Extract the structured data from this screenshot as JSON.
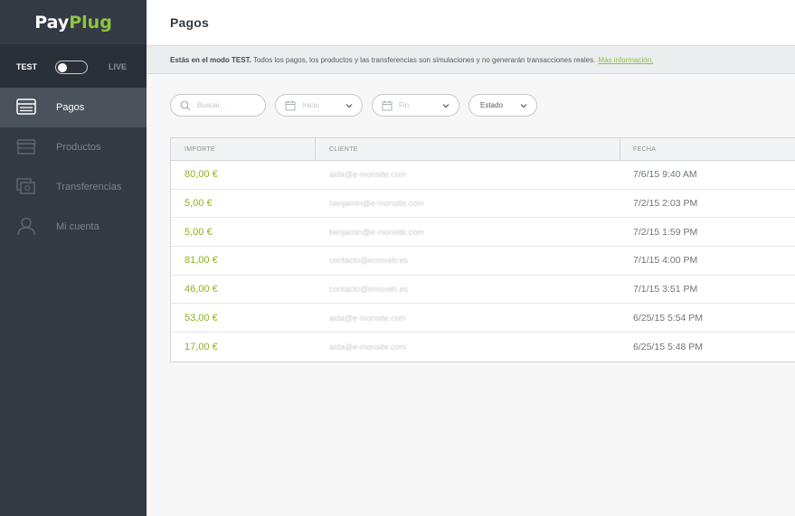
{
  "brand": {
    "part1": "Pay",
    "part2": "Plug",
    "accent": "#8dc63f"
  },
  "mode": {
    "test_label": "TEST",
    "live_label": "LIVE"
  },
  "nav": [
    {
      "label": "Pagos",
      "icon": "payments-list-icon",
      "active": true
    },
    {
      "label": "Productos",
      "icon": "store-icon",
      "active": false
    },
    {
      "label": "Transferencias",
      "icon": "transfers-icon",
      "active": false
    },
    {
      "label": "Mi cuenta",
      "icon": "user-icon",
      "active": false
    }
  ],
  "header": {
    "title": "Pagos"
  },
  "banner": {
    "bold": "Estás en el modo TEST.",
    "text": " Todos los pagos, los productos y las transferencias son simulaciones y no generarán transacciones reales.",
    "link": "Más información."
  },
  "filters": {
    "search_placeholder": "Buscar...",
    "start_placeholder": "Inicio",
    "end_placeholder": "Fin",
    "status_label": "Estado"
  },
  "table": {
    "headers": {
      "amount": "IMPORTE",
      "client": "CLIENTE",
      "date": "FECHA"
    },
    "rows": [
      {
        "amount": "80,00 €",
        "client": "aida@e-monsite.com",
        "date": "7/6/15 9:40 AM"
      },
      {
        "amount": "5,00 €",
        "client": "benjamin@e-monsite.com",
        "date": "7/2/15 2:03 PM"
      },
      {
        "amount": "5,00 €",
        "client": "benjamin@e-monsite.com",
        "date": "7/2/15 1:59 PM"
      },
      {
        "amount": "81,00 €",
        "client": "contacto@emoveb.es",
        "date": "7/1/15 4:00 PM"
      },
      {
        "amount": "46,00 €",
        "client": "contacto@emoveb.es",
        "date": "7/1/15 3:51 PM"
      },
      {
        "amount": "53,00 €",
        "client": "aida@e-monsite.com",
        "date": "6/25/15 5:54 PM"
      },
      {
        "amount": "17,00 €",
        "client": "aida@e-monsite.com",
        "date": "6/25/15 5:48 PM"
      }
    ]
  }
}
